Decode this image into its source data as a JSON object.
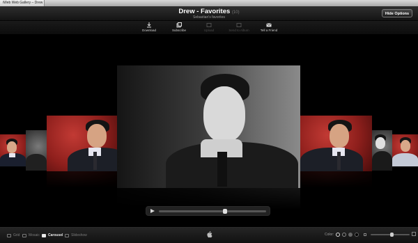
{
  "browser": {
    "tab_title": "iWeb Web Gallery – Drew"
  },
  "header": {
    "title": "Drew - Favorites",
    "count": "(10)",
    "subtitle": "Sebastian's favorites",
    "hide_options_label": "Hide Options"
  },
  "toolbar": {
    "items": [
      {
        "label": "Download",
        "icon": "download-icon",
        "enabled": true
      },
      {
        "label": "Subscribe",
        "icon": "subscribe-icon",
        "enabled": true
      },
      {
        "label": "Upload",
        "icon": "upload-icon",
        "enabled": false
      },
      {
        "label": "Send to Album",
        "icon": "send-to-album-icon",
        "enabled": false
      },
      {
        "label": "Tell a Friend",
        "icon": "mail-icon",
        "enabled": true
      }
    ]
  },
  "carousel": {
    "selected_index": 2,
    "photos": [
      {
        "name": "portrait-red-far-left",
        "style": "red"
      },
      {
        "name": "portrait-grey-left",
        "style": "grey"
      },
      {
        "name": "portrait-red-left",
        "style": "red"
      },
      {
        "name": "portrait-bw-center",
        "style": "bw"
      },
      {
        "name": "portrait-red-right",
        "style": "red"
      },
      {
        "name": "portrait-grey-right",
        "style": "grey"
      },
      {
        "name": "portrait-red-far-right",
        "style": "red"
      }
    ],
    "scrubber_position": 0.62
  },
  "footer": {
    "views": [
      {
        "label": "Grid",
        "active": false
      },
      {
        "label": "Mosaic",
        "active": false
      },
      {
        "label": "Carousel",
        "active": true
      },
      {
        "label": "Slideshow",
        "active": false
      }
    ],
    "color_label": "Color:",
    "color_swatches": [
      "#ffffff",
      "#888888",
      "#444444",
      "#000000"
    ],
    "zoom_level": 0.55,
    "colors": {
      "accent": "#ffffff",
      "background": "#000000"
    }
  }
}
